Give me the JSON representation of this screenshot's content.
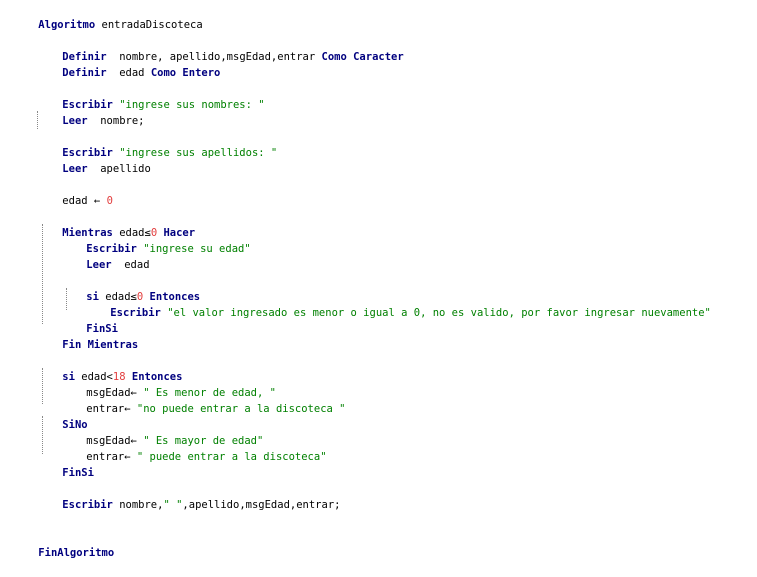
{
  "code": {
    "l1": [
      "Algoritmo",
      " entradaDiscoteca"
    ],
    "l2": [
      "Definir",
      "  nombre, apellido,msgEdad,entrar ",
      "Como Caracter"
    ],
    "l3": [
      "Definir",
      "  edad ",
      "Como Entero"
    ],
    "l4": [
      "Escribir",
      " ",
      "\"ingrese sus nombres: \""
    ],
    "l5": [
      "Leer",
      "  nombre;"
    ],
    "l6": [
      "Escribir",
      " ",
      "\"ingrese sus apellidos: \""
    ],
    "l7": [
      "Leer",
      "  apellido"
    ],
    "l8": [
      "edad ← ",
      "0"
    ],
    "l9": [
      "Mientras",
      " edad≤",
      "0",
      " ",
      "Hacer"
    ],
    "l10": [
      "Escribir",
      " ",
      "\"ingrese su edad\""
    ],
    "l11": [
      "Leer",
      "  edad"
    ],
    "l12": [
      "si",
      " edad≤",
      "0",
      " ",
      "Entonces"
    ],
    "l13": [
      "Escribir",
      " ",
      "\"el valor ingresado es menor o igual a 0, no es valido, por favor ingresar nuevamente\""
    ],
    "l14": [
      "FinSi"
    ],
    "l15": [
      "Fin Mientras"
    ],
    "l16": [
      "si",
      " edad<",
      "18",
      " ",
      "Entonces"
    ],
    "l17": [
      "msgEdad← ",
      "\" Es menor de edad, \""
    ],
    "l18": [
      "entrar← ",
      "\"no puede entrar a la discoteca \""
    ],
    "l19": [
      "SiNo"
    ],
    "l20": [
      "msgEdad← ",
      "\" Es mayor de edad\""
    ],
    "l21": [
      "entrar← ",
      "\" puede entrar a la discoteca\""
    ],
    "l22": [
      "FinSi"
    ],
    "l23": [
      "Escribir",
      " nombre,",
      "\" \"",
      ",apellido,msgEdad,entrar;"
    ],
    "l24": [
      "FinAlgoritmo"
    ]
  }
}
